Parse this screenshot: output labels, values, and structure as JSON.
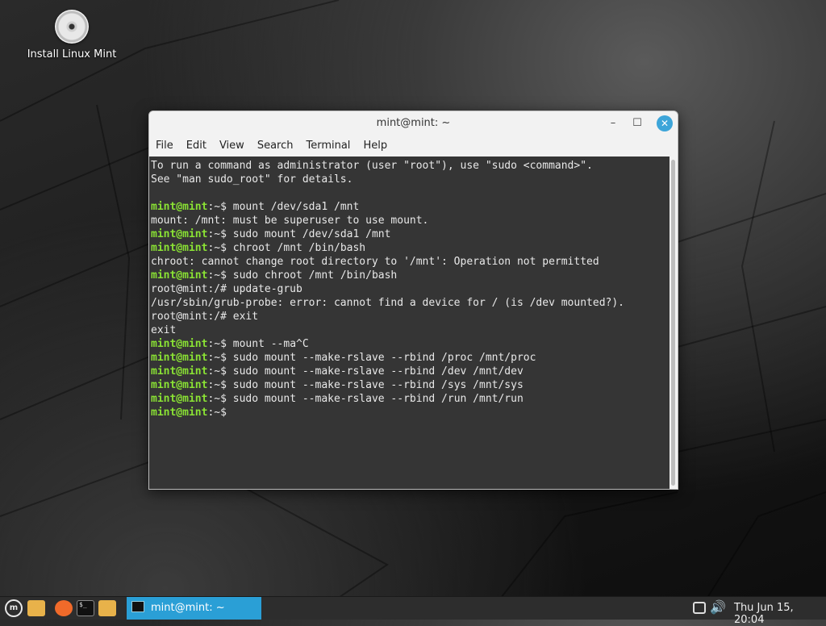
{
  "desktop": {
    "icon_label": "Install Linux Mint"
  },
  "window": {
    "title": "mint@mint: ~",
    "menu": [
      "File",
      "Edit",
      "View",
      "Search",
      "Terminal",
      "Help"
    ],
    "prompt_user": "mint@mint",
    "prompt_path": ":~$ ",
    "lines": [
      {
        "t": "out",
        "text": "To run a command as administrator (user \"root\"), use \"sudo <command>\"."
      },
      {
        "t": "out",
        "text": "See \"man sudo_root\" for details."
      },
      {
        "t": "out",
        "text": ""
      },
      {
        "t": "cmd",
        "text": "mount /dev/sda1 /mnt"
      },
      {
        "t": "out",
        "text": "mount: /mnt: must be superuser to use mount."
      },
      {
        "t": "cmd",
        "text": "sudo mount /dev/sda1 /mnt"
      },
      {
        "t": "cmd",
        "text": "chroot /mnt /bin/bash"
      },
      {
        "t": "out",
        "text": "chroot: cannot change root directory to '/mnt': Operation not permitted"
      },
      {
        "t": "cmd",
        "text": "sudo chroot /mnt /bin/bash"
      },
      {
        "t": "out",
        "text": "root@mint:/# update-grub"
      },
      {
        "t": "out",
        "text": "/usr/sbin/grub-probe: error: cannot find a device for / (is /dev mounted?)."
      },
      {
        "t": "out",
        "text": "root@mint:/# exit"
      },
      {
        "t": "out",
        "text": "exit"
      },
      {
        "t": "cmd",
        "text": "mount --ma^C"
      },
      {
        "t": "cmd",
        "text": "sudo mount --make-rslave --rbind /proc /mnt/proc"
      },
      {
        "t": "cmd",
        "text": "sudo mount --make-rslave --rbind /dev /mnt/dev"
      },
      {
        "t": "cmd",
        "text": "sudo mount --make-rslave --rbind /sys /mnt/sys"
      },
      {
        "t": "cmd",
        "text": "sudo mount --make-rslave --rbind /run /mnt/run"
      },
      {
        "t": "cmd",
        "text": ""
      }
    ]
  },
  "taskbar": {
    "task_label": "mint@mint: ~",
    "clock": "Thu Jun 15, 20:04",
    "icons": [
      "mint-menu-icon",
      "files-icon",
      "firefox-icon",
      "terminal-icon",
      "folder-icon",
      "notification-icon",
      "volume-icon"
    ]
  },
  "colors": {
    "accent": "#2a9fd6",
    "prompt": "#8ae234",
    "terminal_bg": "#353535"
  }
}
